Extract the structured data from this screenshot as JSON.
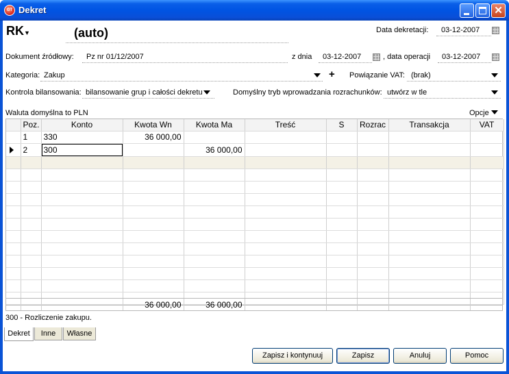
{
  "window": {
    "title": "Dekret",
    "icon": "app-logo-icon",
    "icon_text": "GT"
  },
  "header": {
    "journal": "RK",
    "document_number": "(auto)",
    "date_label": "Data dekretacji:",
    "date_value": "03-12-2007"
  },
  "source_doc": {
    "label": "Dokument źródłowy:",
    "value": "Pz nr 01/12/2007",
    "from_date_label": "z dnia",
    "from_date_value": "03-12-2007",
    "operation_label": ", data operacji",
    "operation_value": "03-12-2007"
  },
  "category": {
    "label": "Kategoria:",
    "value": "Zakup",
    "plus": "+",
    "vat_label": "Powiązanie VAT:",
    "vat_value": "(brak)"
  },
  "balance": {
    "label": "Kontrola bilansowania:",
    "value": "bilansowanie grup i całości dekretu",
    "settle_label": "Domyślny tryb wprowadzania rozrachunków:",
    "settle_value": "utwórz w tle"
  },
  "currency_link": "Waluta domyślna to PLN",
  "options_label": "Opcje",
  "grid": {
    "columns": [
      "Poz.",
      "Konto",
      "Kwota Wn",
      "Kwota Ma",
      "Treść",
      "S",
      "Rozrac",
      "Transakcja",
      "VAT"
    ],
    "rows": [
      {
        "poz": "1",
        "konto": "330",
        "wn": "36 000,00",
        "ma": ""
      },
      {
        "poz": "2",
        "konto": "300",
        "wn": "",
        "ma": "36 000,00"
      }
    ],
    "totals": {
      "wn": "36 000,00",
      "ma": "36 000,00"
    }
  },
  "status_text": "300 - Rozliczenie zakupu.",
  "tabs": [
    "Dekret",
    "Inne",
    "Własne"
  ],
  "buttons": {
    "save_continue": "Zapisz i kontynuuj",
    "save": "Zapisz",
    "cancel": "Anuluj",
    "help": "Pomoc"
  },
  "colors": {
    "titlebar": "#0054e3",
    "zebra": "#f4f1e6",
    "close_button": "#c8441d"
  }
}
